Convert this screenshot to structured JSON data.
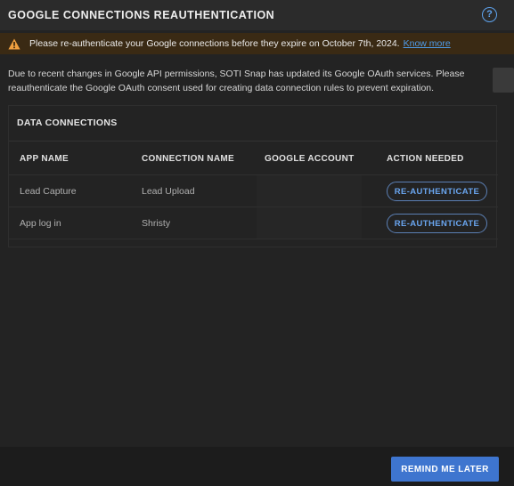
{
  "dialog": {
    "title": "GOOGLE CONNECTIONS REAUTHENTICATION",
    "help_icon": "question-circle-icon",
    "help_glyph": "?"
  },
  "alert": {
    "icon": "warning-triangle-icon",
    "text": "Please re-authenticate your Google connections before they expire on October 7th, 2024.",
    "link": "Know more",
    "bg_color": "#3a2a14",
    "icon_color": "#f0a040"
  },
  "description": "Due to recent changes in Google API permissions, SOTI Snap has updated its Google OAuth services. Please reauthenticate the Google OAuth consent used for creating data connection rules to prevent expiration.",
  "data_connections": {
    "title": "DATA CONNECTIONS",
    "columns": [
      "APP NAME",
      "CONNECTION NAME",
      "GOOGLE ACCOUNT",
      "ACTION NEEDED"
    ],
    "rows": [
      {
        "app_name": "Lead Capture",
        "connection_name": "Lead Upload",
        "google_account": "",
        "action": "RE-AUTHENTICATE"
      },
      {
        "app_name": "App log in",
        "connection_name": "Shristy",
        "google_account": "",
        "action": "RE-AUTHENTICATE"
      }
    ]
  },
  "footer": {
    "remind_label": "REMIND ME LATER",
    "accent_color": "#3e75cf"
  }
}
